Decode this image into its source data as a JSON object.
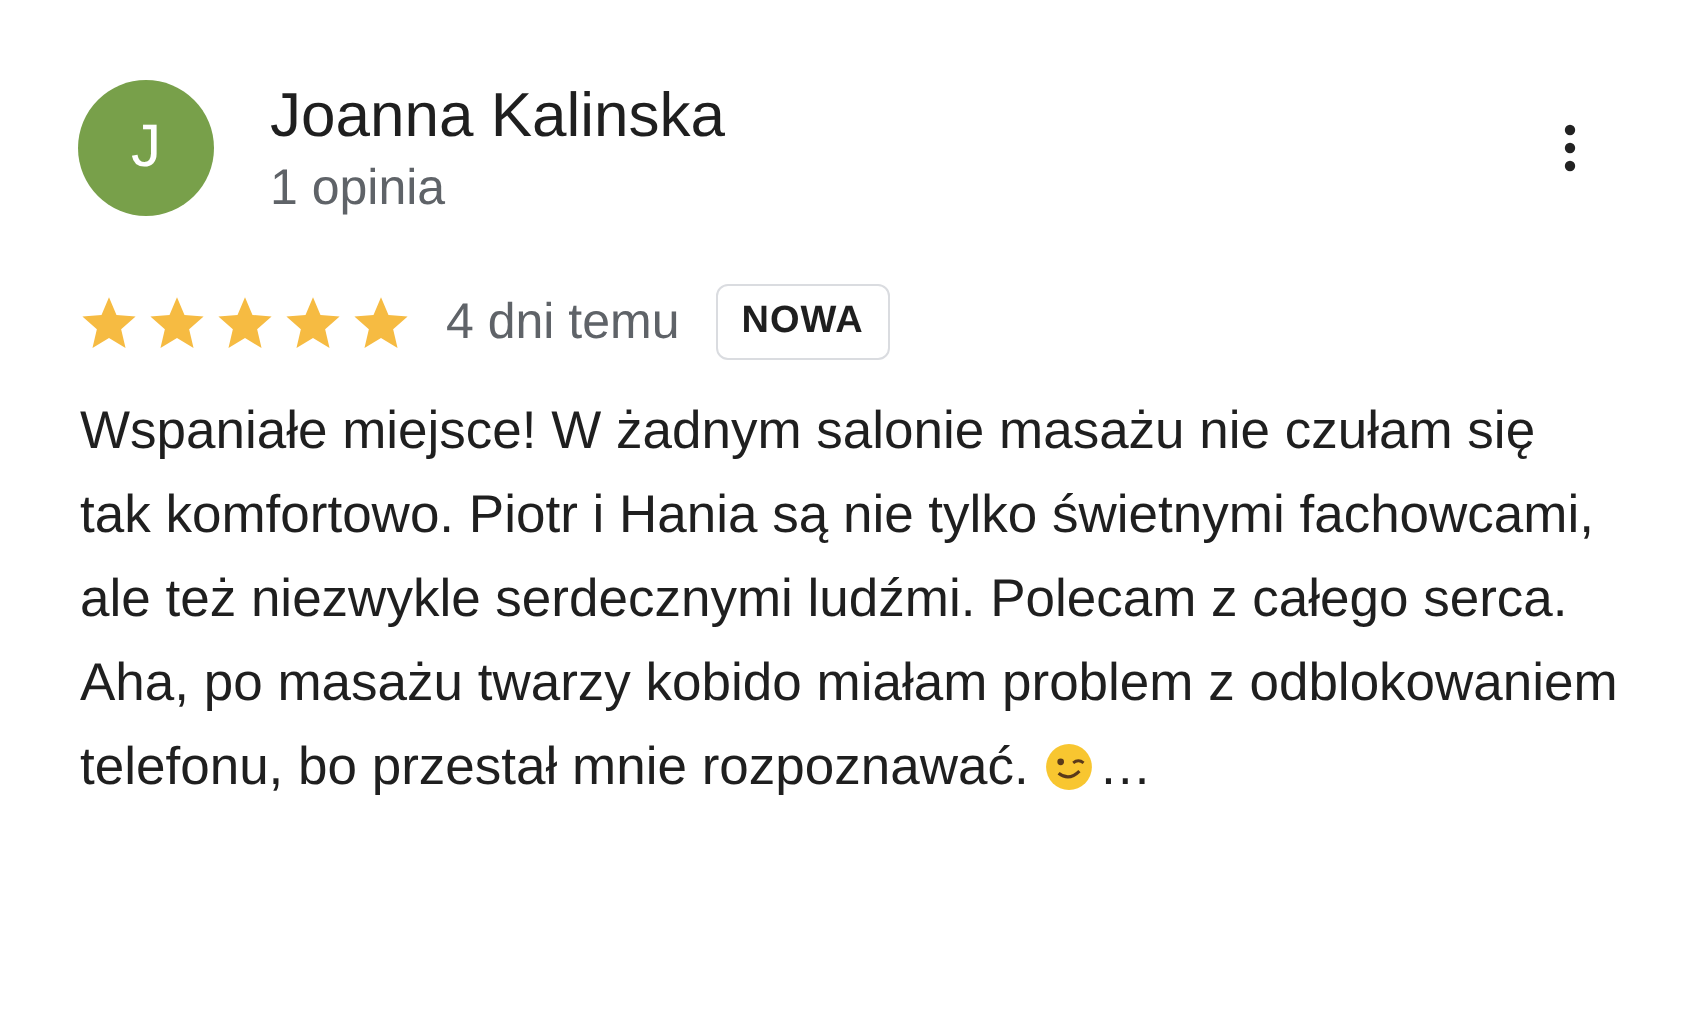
{
  "review": {
    "avatar_letter": "J",
    "author": "Joanna Kalinska",
    "author_meta": "1 opinia",
    "stars": 5,
    "time": "4 dni temu",
    "badge": "NOWA",
    "text": "Wspaniałe miejsce! W żadnym salonie masażu nie czułam się tak komfortowo. Piotr i Hania są nie tylko świetnymi fachowcami, ale też niezwykle serdecznymi ludźmi. Polecam z całego serca. Aha, po masażu twarzy kobido miałam problem z odblokowaniem telefonu, bo przestał mnie rozpoznawać.",
    "more": "…"
  }
}
